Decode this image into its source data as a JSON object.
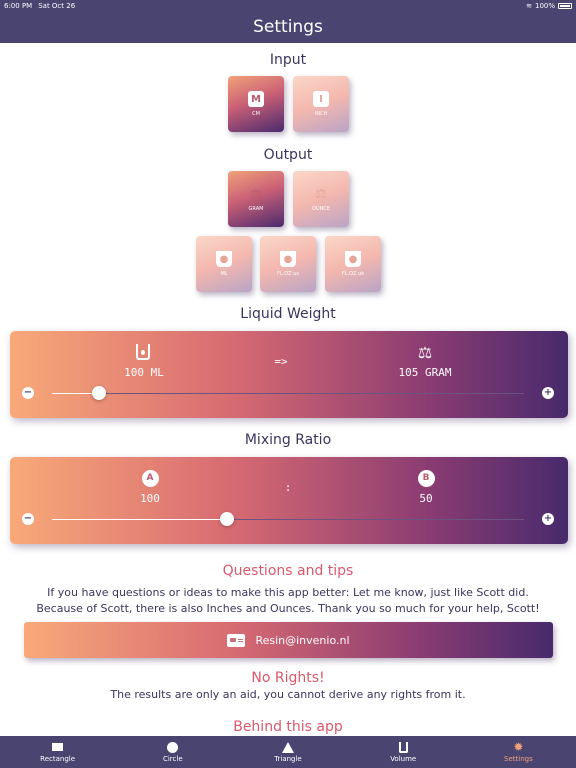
{
  "status": {
    "time": "6:00 PM",
    "date": "Sat Oct 26",
    "battery": "100%"
  },
  "nav": {
    "title": "Settings"
  },
  "input": {
    "title": "Input",
    "options": [
      {
        "glyph": "M",
        "label": "CM",
        "selected": true
      },
      {
        "glyph": "I",
        "label": "INCH",
        "selected": false
      }
    ]
  },
  "output": {
    "title": "Output",
    "weight_options": [
      {
        "label": "GRAM",
        "selected": true
      },
      {
        "label": "OUNCE",
        "selected": false
      }
    ],
    "volume_options": [
      {
        "label": "ML",
        "selected": false
      },
      {
        "label": "FL.OZ us",
        "selected": false
      },
      {
        "label": "FL.OZ uk",
        "selected": false
      }
    ]
  },
  "liquid_weight": {
    "title": "Liquid Weight",
    "from_value": "100 ML",
    "arrow": "=>",
    "to_value": "105 GRAM",
    "minus": "−",
    "plus": "+",
    "slider_level": 0.1
  },
  "mixing_ratio": {
    "title": "Mixing Ratio",
    "a_label": "A",
    "a_value": "100",
    "separator": ":",
    "b_label": "B",
    "b_value": "50",
    "minus": "−",
    "plus": "+",
    "slider_level": 0.37
  },
  "questions": {
    "title": "Questions and tips",
    "line1": "If you have questions or ideas to make this app better: Let me know, just like Scott did.",
    "line2": "Because of Scott, there is also Inches and Ounces. Thank you so much for your help, Scott!",
    "email": "Resin@invenio.nl"
  },
  "no_rights": {
    "title": "No Rights!",
    "text": "The results are only an aid, you cannot derive any rights from it."
  },
  "behind": {
    "title": "Behind this app"
  },
  "tabs": [
    {
      "label": "Rectangle",
      "icon": "rectangle-icon"
    },
    {
      "label": "Circle",
      "icon": "circle-icon"
    },
    {
      "label": "Triangle",
      "icon": "triangle-icon"
    },
    {
      "label": "Volume",
      "icon": "volume-icon"
    },
    {
      "label": "Settings",
      "icon": "gear-icon",
      "selected": true
    }
  ],
  "colors": {
    "nav": "#4a4470",
    "accent": "#f3a37b",
    "red": "#d9596c",
    "text": "#3b355e"
  }
}
